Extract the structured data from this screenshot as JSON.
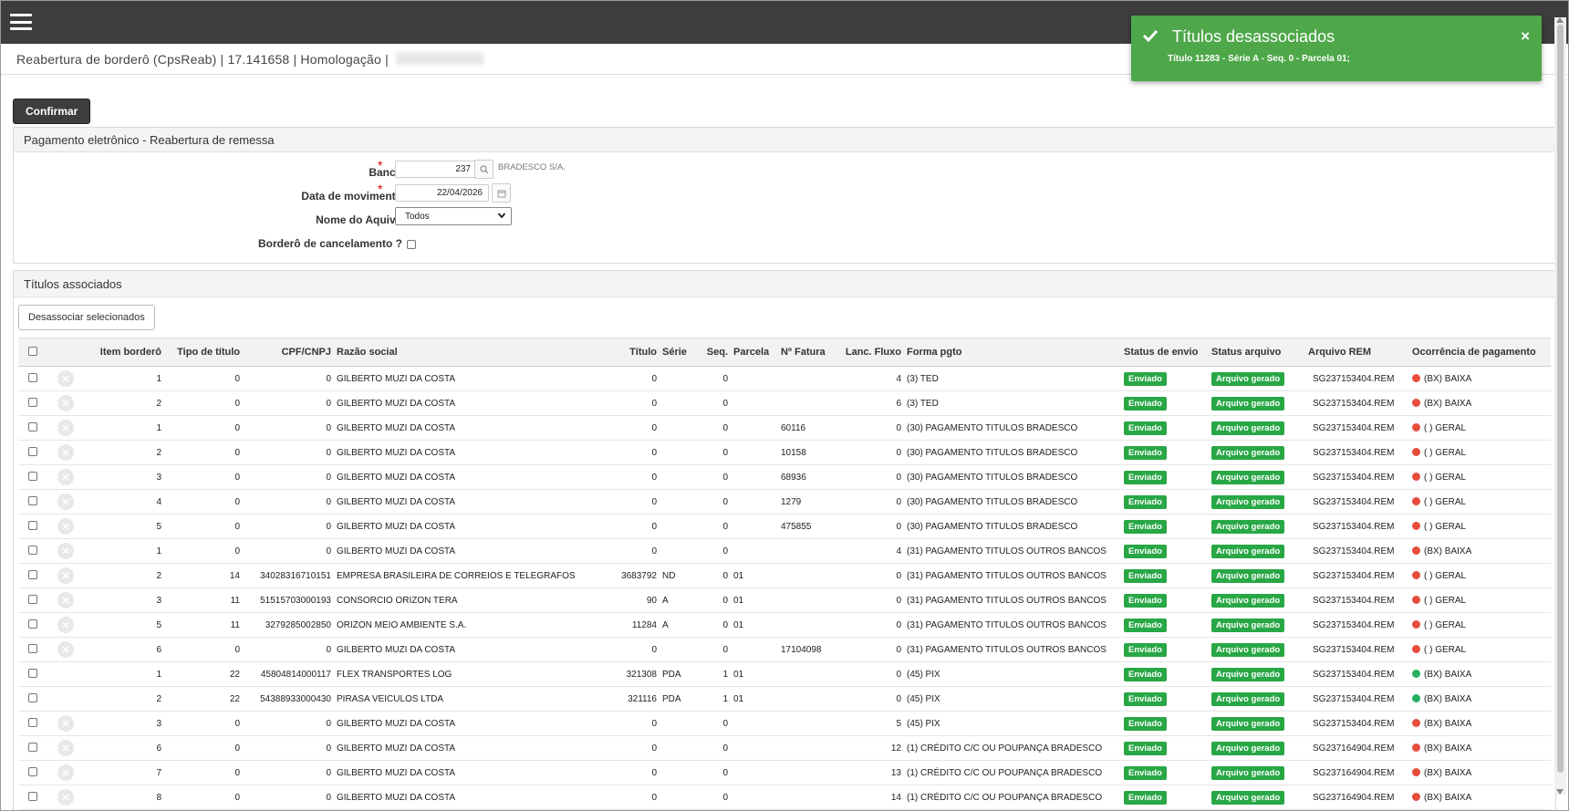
{
  "header": {
    "title": "Reabertura de borderô (CpsReab) | 17.141658 | Homologação |"
  },
  "toolbar": {
    "confirm_label": "Confirmar"
  },
  "form": {
    "title": "Pagamento eletrônico - Reabertura de remessa",
    "banco_label": "Banco",
    "banco_value": "237",
    "banco_desc": "BRADESCO S/A.",
    "data_label": "Data de movimento",
    "data_value": "22/04/2026",
    "arquivo_label": "Nome do Aquivo",
    "arquivo_value": "Todos",
    "cancel_label": "Borderô de cancelamento ?",
    "required_mark": "*"
  },
  "titulos": {
    "title": "Títulos associados",
    "disassociate_label": "Desassociar selecionados",
    "columns": [
      "Item borderô",
      "Tipo de título",
      "CPF/CNPJ",
      "Razão social",
      "Título",
      "Série",
      "Seq.",
      "Parcela",
      "Nº Fatura",
      "Lanc. Fluxo",
      "Forma pgto",
      "Status de envio",
      "Status arquivo",
      "Arquivo REM",
      "Ocorrência de pagamento"
    ],
    "rows": [
      {
        "item": "1",
        "tipo": "0",
        "cnpj": "0",
        "razao": "GILBERTO MUZI DA COSTA",
        "titulo": "0",
        "serie": "",
        "seq": "0",
        "parcela": "",
        "fatura": "",
        "lanc": "4",
        "forma": "(3) TED",
        "envio": "Enviado",
        "arquivo": "Arquivo gerado",
        "rem": "SG237153404.REM",
        "ocorr": "(BX) BAIXA",
        "dot": "#e74c3c",
        "x": true
      },
      {
        "item": "2",
        "tipo": "0",
        "cnpj": "0",
        "razao": "GILBERTO MUZI DA COSTA",
        "titulo": "0",
        "serie": "",
        "seq": "0",
        "parcela": "",
        "fatura": "",
        "lanc": "6",
        "forma": "(3) TED",
        "envio": "Enviado",
        "arquivo": "Arquivo gerado",
        "rem": "SG237153404.REM",
        "ocorr": "(BX) BAIXA",
        "dot": "#e74c3c",
        "x": true
      },
      {
        "item": "1",
        "tipo": "0",
        "cnpj": "0",
        "razao": "GILBERTO MUZI DA COSTA",
        "titulo": "0",
        "serie": "",
        "seq": "0",
        "parcela": "",
        "fatura": "60116",
        "lanc": "0",
        "forma": "(30) PAGAMENTO TITULOS BRADESCO",
        "envio": "Enviado",
        "arquivo": "Arquivo gerado",
        "rem": "SG237153404.REM",
        "ocorr": "( ) GERAL",
        "dot": "#e74c3c",
        "x": true
      },
      {
        "item": "2",
        "tipo": "0",
        "cnpj": "0",
        "razao": "GILBERTO MUZI DA COSTA",
        "titulo": "0",
        "serie": "",
        "seq": "0",
        "parcela": "",
        "fatura": "10158",
        "lanc": "0",
        "forma": "(30) PAGAMENTO TITULOS BRADESCO",
        "envio": "Enviado",
        "arquivo": "Arquivo gerado",
        "rem": "SG237153404.REM",
        "ocorr": "( ) GERAL",
        "dot": "#e74c3c",
        "x": true
      },
      {
        "item": "3",
        "tipo": "0",
        "cnpj": "0",
        "razao": "GILBERTO MUZI DA COSTA",
        "titulo": "0",
        "serie": "",
        "seq": "0",
        "parcela": "",
        "fatura": "68936",
        "lanc": "0",
        "forma": "(30) PAGAMENTO TITULOS BRADESCO",
        "envio": "Enviado",
        "arquivo": "Arquivo gerado",
        "rem": "SG237153404.REM",
        "ocorr": "( ) GERAL",
        "dot": "#e74c3c",
        "x": true
      },
      {
        "item": "4",
        "tipo": "0",
        "cnpj": "0",
        "razao": "GILBERTO MUZI DA COSTA",
        "titulo": "0",
        "serie": "",
        "seq": "0",
        "parcela": "",
        "fatura": "1279",
        "lanc": "0",
        "forma": "(30) PAGAMENTO TITULOS BRADESCO",
        "envio": "Enviado",
        "arquivo": "Arquivo gerado",
        "rem": "SG237153404.REM",
        "ocorr": "( ) GERAL",
        "dot": "#e74c3c",
        "x": true
      },
      {
        "item": "5",
        "tipo": "0",
        "cnpj": "0",
        "razao": "GILBERTO MUZI DA COSTA",
        "titulo": "0",
        "serie": "",
        "seq": "0",
        "parcela": "",
        "fatura": "475855",
        "lanc": "0",
        "forma": "(30) PAGAMENTO TITULOS BRADESCO",
        "envio": "Enviado",
        "arquivo": "Arquivo gerado",
        "rem": "SG237153404.REM",
        "ocorr": "( ) GERAL",
        "dot": "#e74c3c",
        "x": true
      },
      {
        "item": "1",
        "tipo": "0",
        "cnpj": "0",
        "razao": "GILBERTO MUZI DA COSTA",
        "titulo": "0",
        "serie": "",
        "seq": "0",
        "parcela": "",
        "fatura": "",
        "lanc": "4",
        "forma": "(31) PAGAMENTO TITULOS OUTROS BANCOS",
        "envio": "Enviado",
        "arquivo": "Arquivo gerado",
        "rem": "SG237153404.REM",
        "ocorr": "(BX) BAIXA",
        "dot": "#e74c3c",
        "x": true
      },
      {
        "item": "2",
        "tipo": "14",
        "cnpj": "34028316710151",
        "razao": "EMPRESA BRASILEIRA DE CORREIOS E TELEGRAFOS",
        "titulo": "3683792",
        "serie": "ND",
        "seq": "0",
        "parcela": "01",
        "fatura": "",
        "lanc": "0",
        "forma": "(31) PAGAMENTO TITULOS OUTROS BANCOS",
        "envio": "Enviado",
        "arquivo": "Arquivo gerado",
        "rem": "SG237153404.REM",
        "ocorr": "( ) GERAL",
        "dot": "#e74c3c",
        "x": true
      },
      {
        "item": "3",
        "tipo": "11",
        "cnpj": "51515703000193",
        "razao": "CONSORCIO ORIZON TERA",
        "titulo": "90",
        "serie": "A",
        "seq": "0",
        "parcela": "01",
        "fatura": "",
        "lanc": "0",
        "forma": "(31) PAGAMENTO TITULOS OUTROS BANCOS",
        "envio": "Enviado",
        "arquivo": "Arquivo gerado",
        "rem": "SG237153404.REM",
        "ocorr": "( ) GERAL",
        "dot": "#e74c3c",
        "x": true
      },
      {
        "item": "5",
        "tipo": "11",
        "cnpj": "3279285002850",
        "razao": "ORIZON MEIO AMBIENTE S.A.",
        "titulo": "11284",
        "serie": "A",
        "seq": "0",
        "parcela": "01",
        "fatura": "",
        "lanc": "0",
        "forma": "(31) PAGAMENTO TITULOS OUTROS BANCOS",
        "envio": "Enviado",
        "arquivo": "Arquivo gerado",
        "rem": "SG237153404.REM",
        "ocorr": "( ) GERAL",
        "dot": "#e74c3c",
        "x": true
      },
      {
        "item": "6",
        "tipo": "0",
        "cnpj": "0",
        "razao": "GILBERTO MUZI DA COSTA",
        "titulo": "0",
        "serie": "",
        "seq": "0",
        "parcela": "",
        "fatura": "17104098",
        "lanc": "0",
        "forma": "(31) PAGAMENTO TITULOS OUTROS BANCOS",
        "envio": "Enviado",
        "arquivo": "Arquivo gerado",
        "rem": "SG237153404.REM",
        "ocorr": "( ) GERAL",
        "dot": "#e74c3c",
        "x": true
      },
      {
        "item": "1",
        "tipo": "22",
        "cnpj": "45804814000117",
        "razao": "FLEX TRANSPORTES LOG",
        "titulo": "321308",
        "serie": "PDA",
        "seq": "1",
        "parcela": "01",
        "fatura": "",
        "lanc": "0",
        "forma": "(45) PIX",
        "envio": "Enviado",
        "arquivo": "Arquivo gerado",
        "rem": "SG237153404.REM",
        "ocorr": "(BX) BAIXA",
        "dot": "#27ae60",
        "x": false
      },
      {
        "item": "2",
        "tipo": "22",
        "cnpj": "54388933000430",
        "razao": "PIRASA VEICULOS LTDA",
        "titulo": "321116",
        "serie": "PDA",
        "seq": "1",
        "parcela": "01",
        "fatura": "",
        "lanc": "0",
        "forma": "(45) PIX",
        "envio": "Enviado",
        "arquivo": "Arquivo gerado",
        "rem": "SG237153404.REM",
        "ocorr": "(BX) BAIXA",
        "dot": "#27ae60",
        "x": false
      },
      {
        "item": "3",
        "tipo": "0",
        "cnpj": "0",
        "razao": "GILBERTO MUZI DA COSTA",
        "titulo": "0",
        "serie": "",
        "seq": "0",
        "parcela": "",
        "fatura": "",
        "lanc": "5",
        "forma": "(45) PIX",
        "envio": "Enviado",
        "arquivo": "Arquivo gerado",
        "rem": "SG237153404.REM",
        "ocorr": "(BX) BAIXA",
        "dot": "#e74c3c",
        "x": true
      },
      {
        "item": "6",
        "tipo": "0",
        "cnpj": "0",
        "razao": "GILBERTO MUZI DA COSTA",
        "titulo": "0",
        "serie": "",
        "seq": "0",
        "parcela": "",
        "fatura": "",
        "lanc": "12",
        "forma": "(1) CRÉDITO C/C OU POUPANÇA BRADESCO",
        "envio": "Enviado",
        "arquivo": "Arquivo gerado",
        "rem": "SG237164904.REM",
        "ocorr": "(BX) BAIXA",
        "dot": "#e74c3c",
        "x": true
      },
      {
        "item": "7",
        "tipo": "0",
        "cnpj": "0",
        "razao": "GILBERTO MUZI DA COSTA",
        "titulo": "0",
        "serie": "",
        "seq": "0",
        "parcela": "",
        "fatura": "",
        "lanc": "13",
        "forma": "(1) CRÉDITO C/C OU POUPANÇA BRADESCO",
        "envio": "Enviado",
        "arquivo": "Arquivo gerado",
        "rem": "SG237164904.REM",
        "ocorr": "(BX) BAIXA",
        "dot": "#e74c3c",
        "x": true
      },
      {
        "item": "8",
        "tipo": "0",
        "cnpj": "0",
        "razao": "GILBERTO MUZI DA COSTA",
        "titulo": "0",
        "serie": "",
        "seq": "0",
        "parcela": "",
        "fatura": "",
        "lanc": "14",
        "forma": "(1) CRÉDITO C/C OU POUPANÇA BRADESCO",
        "envio": "Enviado",
        "arquivo": "Arquivo gerado",
        "rem": "SG237164904.REM",
        "ocorr": "(BX) BAIXA",
        "dot": "#e74c3c",
        "x": true
      }
    ]
  },
  "toast": {
    "title": "Títulos desassociados",
    "message": "Título 11283 - Série A - Seq. 0 - Parcela 01;",
    "close": "×"
  },
  "colors": {
    "topbar": "#3d3d3d",
    "success": "#28a745",
    "toast": "#4ea84a",
    "dot_red": "#e74c3c",
    "dot_green": "#27ae60"
  }
}
